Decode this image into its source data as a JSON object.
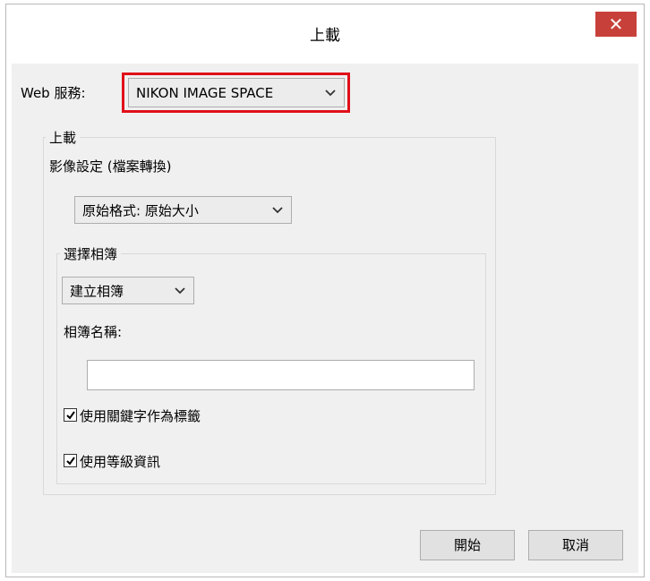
{
  "dialog": {
    "title": "上載",
    "close_symbol": "✕",
    "web_service_label": "Web 服務:",
    "web_service_value": "NIKON IMAGE SPACE",
    "upload_group_label": "上載",
    "image_settings_label": "影像設定 (檔案轉換)",
    "format_value": "原始格式: 原始大小",
    "album_group_label": "選擇相簿",
    "album_mode_value": "建立相簿",
    "album_name_label": "相簿名稱:",
    "album_name_value": "",
    "checkbox_keywords_label": "使用關鍵字作為標籤",
    "checkbox_keywords_checked": true,
    "checkbox_rating_label": "使用等級資訊",
    "checkbox_rating_checked": true,
    "start_button": "開始",
    "cancel_button": "取消"
  },
  "colors": {
    "highlight": "#e0101a",
    "close_button": "#c7413a",
    "client_bg": "#f0f0f0"
  }
}
